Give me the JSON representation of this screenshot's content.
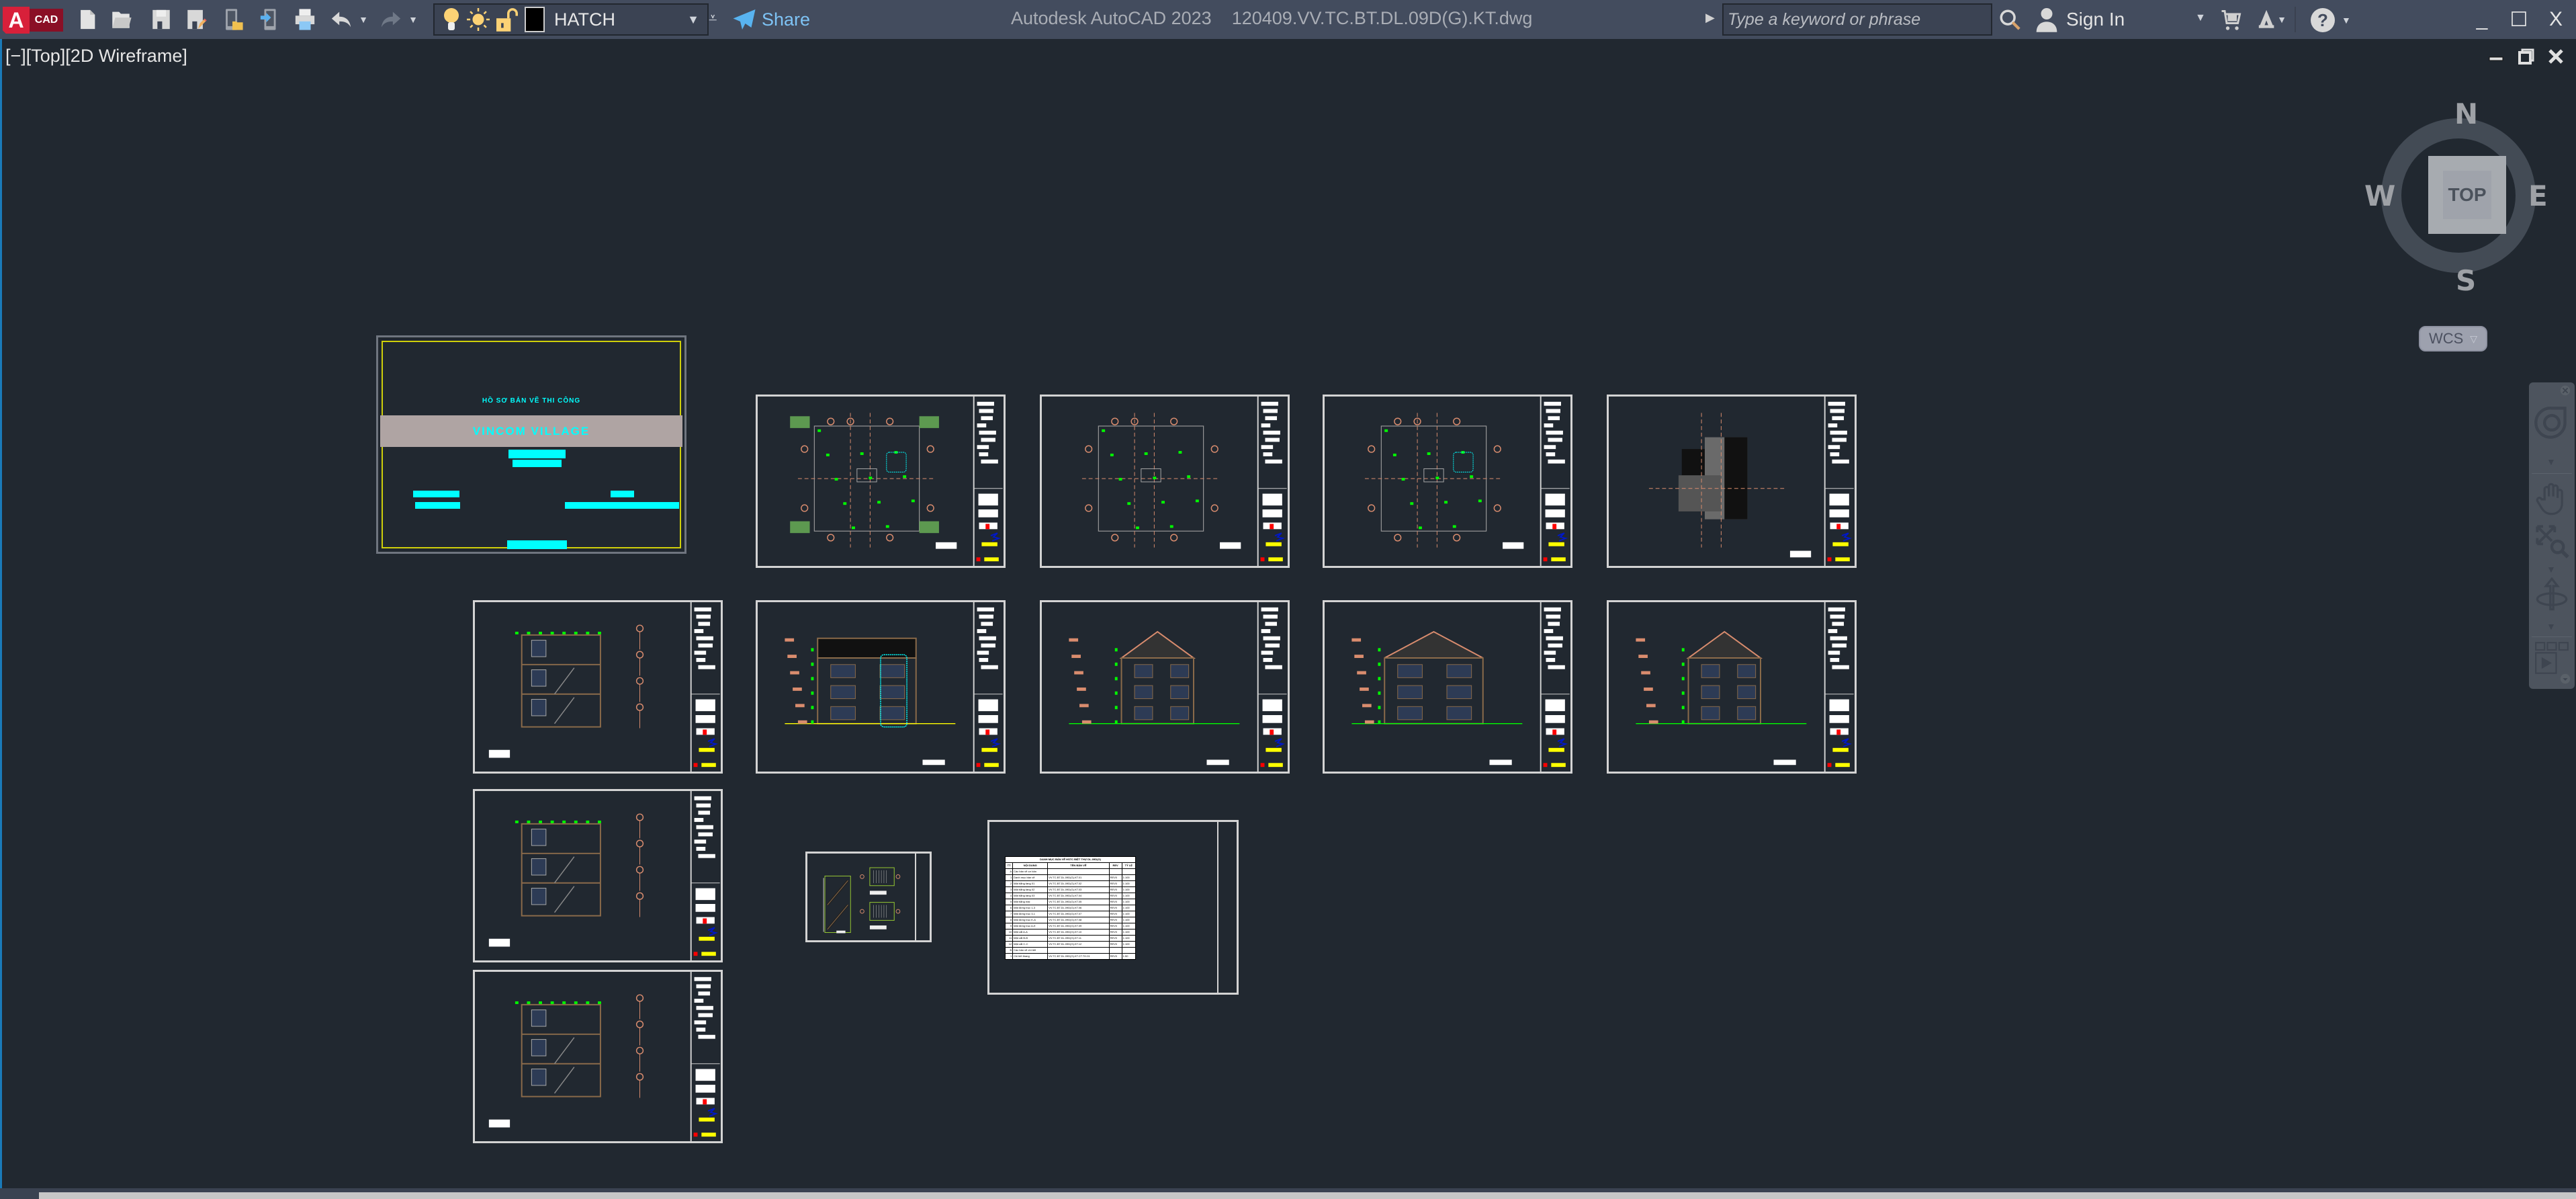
{
  "app": {
    "logo_letter": "A",
    "logo_text": "CAD",
    "title": "Autodesk AutoCAD 2023",
    "filename": "120409.VV.TC.BT.DL.09D(G).KT.dwg"
  },
  "quick_access": {
    "buttons": [
      "new-icon",
      "open-icon",
      "save-icon",
      "save-as-icon",
      "open-from-mobile-icon",
      "save-to-mobile-icon",
      "plot-icon",
      "undo-icon",
      "redo-icon"
    ],
    "layer": {
      "name": "HATCH",
      "color": "#000000",
      "on": true,
      "frozen": false,
      "locked": false
    },
    "share_label": "Share"
  },
  "search": {
    "placeholder": "Type a keyword or phrase",
    "value": ""
  },
  "account": {
    "signin_label": "Sign In"
  },
  "help_label": "?",
  "window_controls": {
    "minimize": "_",
    "maximize": "☐",
    "close": "X"
  },
  "viewport": {
    "label": "[−][Top][2D Wireframe]",
    "controls": [
      "minimize",
      "restore",
      "close"
    ]
  },
  "viewcube": {
    "face": "TOP",
    "north": "N",
    "south": "S",
    "east": "E",
    "west": "W",
    "ucs": "WCS"
  },
  "navbar": {
    "tools": [
      "steering-wheel",
      "pan",
      "zoom-extents",
      "orbit",
      "showmotion"
    ]
  },
  "colors": {
    "canvas_bg": "#212830",
    "titlebar_bg": "#434c5e",
    "sheet_border": "#d3d3d3",
    "cyan": "#00ffff",
    "green": "#00ff00",
    "orange": "#d98c6e",
    "yellow": "#ffff00",
    "red": "#ff0000",
    "blue": "#0018c8"
  },
  "cover_sheet": {
    "subtitle": "HỒ SƠ BẢN VẼ THI CÔNG",
    "project": "VINCOM VILLAGE"
  },
  "sheets": [
    {
      "id": "KT.02",
      "kind": "plan",
      "title": "Mặt bằng tầng 01"
    },
    {
      "id": "KT.03",
      "kind": "plan",
      "title": "Mặt bằng tầng 02"
    },
    {
      "id": "KT.04",
      "kind": "plan",
      "title": "Mặt bằng tầng 03"
    },
    {
      "id": "KT.05",
      "kind": "roof",
      "title": "Mặt bằng mái"
    },
    {
      "id": "KT.06",
      "kind": "elevation",
      "title": "Mặt đứng trục 1-3"
    },
    {
      "id": "KT.07",
      "kind": "elevation",
      "title": "Mặt đứng trục 3-1"
    },
    {
      "id": "KT.08",
      "kind": "elevation",
      "title": "Mặt đứng trục E-A"
    },
    {
      "id": "KT.09",
      "kind": "elevation",
      "title": "Mặt đứng trục A-E"
    },
    {
      "id": "KT.10",
      "kind": "section",
      "title": "Mặt cắt A-A"
    },
    {
      "id": "KT.11",
      "kind": "section",
      "title": "Mặt cắt B-B"
    },
    {
      "id": "KT.12",
      "kind": "section",
      "title": "Mặt cắt C-C"
    },
    {
      "id": "KT.CT.TH.01",
      "kind": "detail",
      "title": "Chi tiết thang"
    }
  ],
  "drawing_index": {
    "title": "DANH MỤC BẢN VẼ HSTC BIỆT THỰ DL-09D(G)",
    "headers": [
      "TT",
      "NỘI DUNG",
      "TÊN BẢN VẼ",
      "REV",
      "TỶ LỆ"
    ],
    "rows": [
      [
        "A",
        "Các bản vẽ cơ bản",
        "",
        "",
        ""
      ],
      [
        "1",
        "Danh mục bản vẽ",
        "VV.TC.BT.DL.09D(G).KT.01",
        "REV0",
        "1:100"
      ],
      [
        "2",
        "Mặt bằng tầng 01",
        "VV.TC.BT.DL.09D(G).KT.02",
        "REV0",
        "1:100"
      ],
      [
        "3",
        "Mặt bằng tầng 02",
        "VV.TC.BT.DL.09D(G).KT.03",
        "REV0",
        "1:100"
      ],
      [
        "4",
        "Mặt bằng tầng 03",
        "VV.TC.BT.DL.09D(G).KT.04",
        "REV0",
        "1:100"
      ],
      [
        "5",
        "Mặt bằng mái",
        "VV.TC.BT.DL.09D(G).KT.05",
        "REV0",
        "1:100"
      ],
      [
        "6",
        "Mặt đứng trục 1-3",
        "VV.TC.BT.DL.09D(G).KT.06",
        "REV0",
        "1:100"
      ],
      [
        "7",
        "Mặt đứng trục 3-1",
        "VV.TC.BT.DL.09D(G).KT.07",
        "REV0",
        "1:100"
      ],
      [
        "8",
        "Mặt đứng trục E-A",
        "VV.TC.BT.DL.09D(G).KT.08",
        "REV0",
        "1:100"
      ],
      [
        "9",
        "Mặt đứng trục A-E",
        "VV.TC.BT.DL.09D(G).KT.09",
        "REV0",
        "1:100"
      ],
      [
        "10",
        "Mặt cắt A-A",
        "VV.TC.BT.DL.09D(G).KT.10",
        "REV0",
        "1:100"
      ],
      [
        "11",
        "Mặt cắt B-B",
        "VV.TC.BT.DL.09D(G).KT.11",
        "REV0",
        "1:100"
      ],
      [
        "12",
        "Mặt cắt C-C",
        "VV.TC.BT.DL.09D(G).KT.12",
        "REV0",
        "1:100"
      ],
      [
        "B",
        "Các bản vẽ chi tiết",
        "",
        "",
        ""
      ],
      [
        "1",
        "Chi tiết thang",
        "VV.TC.BT.DL.09D(G).KT.CT.TH.01",
        "REV0",
        "1:50"
      ]
    ]
  }
}
